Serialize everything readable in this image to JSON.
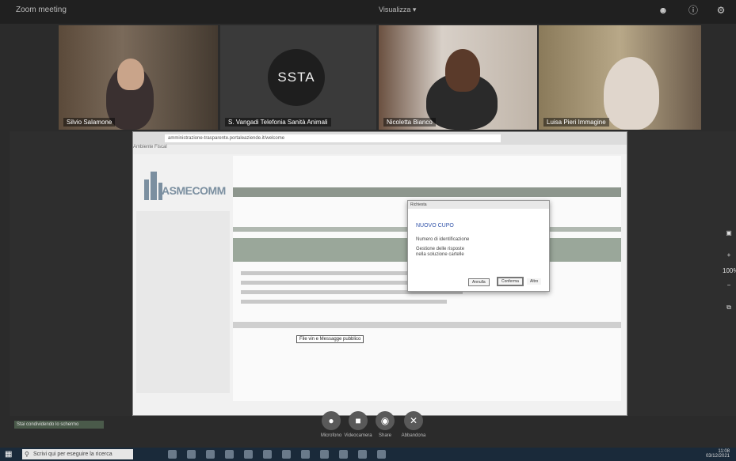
{
  "window": {
    "title": "Zoom meeting",
    "view_label": "Visualizza ▾"
  },
  "participants": [
    {
      "name": "Silvio Salamone"
    },
    {
      "name": "S. Vangadi Telefonia Sanità Animali"
    },
    {
      "name": "Nicoletta Bianco"
    },
    {
      "name": "Luisa Pieri Immagine"
    }
  ],
  "avatar_text": "SSTA",
  "browser": {
    "url": "amministrazione-trasparente.portaleaziende.it/welcome",
    "bookmarks": "Ambiente   Fiscal",
    "logo_text": "ASMECOMM"
  },
  "modal": {
    "header": "Richiesta",
    "title": "NUOVO CUPO",
    "line1": "Numero di identificazione",
    "line2": "Gestione delle risposte",
    "line3": "nella soluzione cartelle",
    "cancel_label": "Annulla",
    "ok_label": "Conferma",
    "extra_label": "Altro"
  },
  "tooltip": "File vin e Messagge pubblico",
  "zoom_level": "100%",
  "controls": [
    {
      "label": "Microfono"
    },
    {
      "label": "Videocamera"
    },
    {
      "label": "Share"
    },
    {
      "label": "Abbandona"
    }
  ],
  "notice": "Stai condividendo lo schermo",
  "taskbar": {
    "search_placeholder": "Scrivi qui per eseguire la ricerca",
    "tray_time": "11:08",
    "tray_date": "03/12/2021"
  }
}
